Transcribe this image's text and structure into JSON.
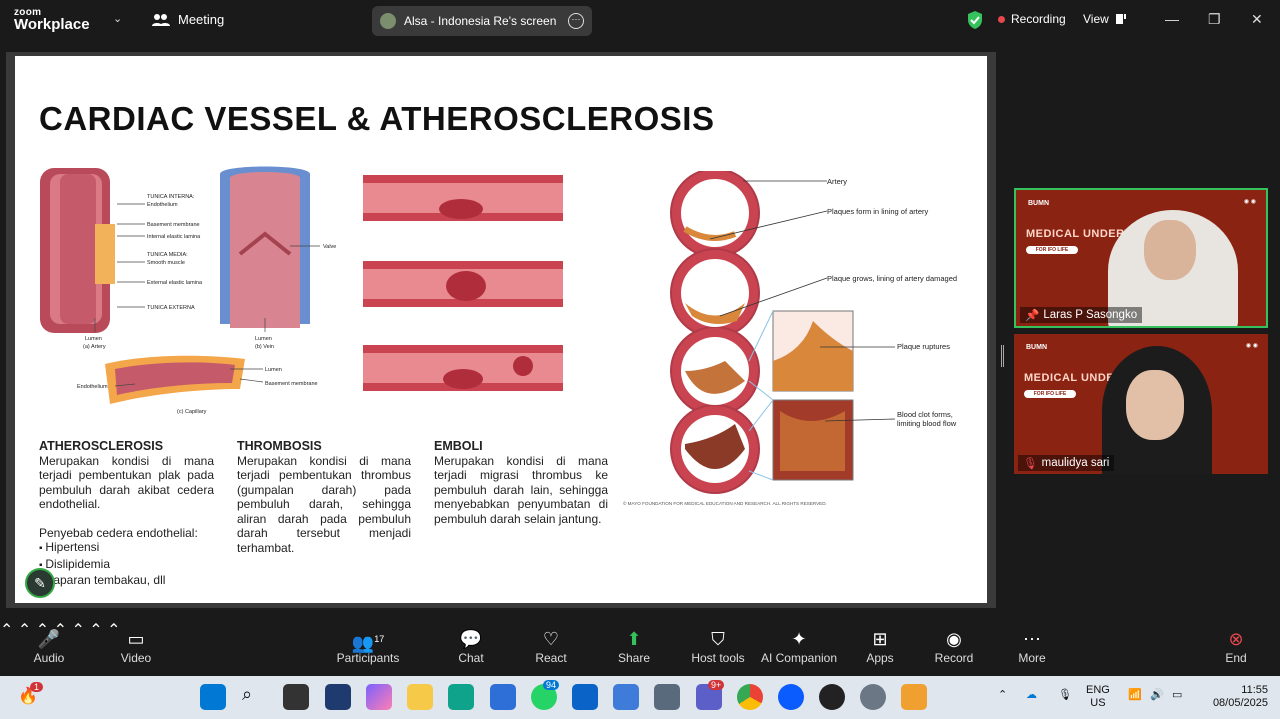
{
  "app": {
    "brand_line1": "zoom",
    "brand_line2": "Workplace",
    "meeting_label": "Meeting",
    "share_label": "Alsa - Indonesia Re's screen",
    "recording": "Recording",
    "view": "View"
  },
  "slide": {
    "title": "CARDIAC VESSEL & ATHEROSCLEROSIS",
    "vessel_labels": {
      "tunica_interna": "TUNICA INTERNA:",
      "endothelium": "Endothelium",
      "basement": "Basement membrane",
      "internal_elastic": "Internal elastic lamina",
      "tunica_media": "TUNICA MEDIA:",
      "smooth": "Smooth muscle",
      "external_elastic": "External elastic lamina",
      "tunica_externa": "TUNICA EXTERNA",
      "valve": "Valve",
      "lumen_a": "Lumen",
      "artery": "(a) Artery",
      "lumen_b": "Lumen",
      "vein": "(b) Vein",
      "lumen_c": "Lumen",
      "endothelium_c": "Endothelium",
      "basement_c": "Basement membrane",
      "capillary": "(c) Capillary"
    },
    "plaque_labels": {
      "artery": "Artery",
      "p1": "Plaques form in lining of artery",
      "p2": "Plaque grows, lining of artery damaged",
      "p3": "Plaque ruptures",
      "p4a": "Blood clot forms,",
      "p4b": "limiting blood flow",
      "copyright": "© MAYO FOUNDATION FOR MEDICAL EDUCATION AND RESEARCH. ALL RIGHTS RESERVED."
    },
    "atherosclerosis": {
      "heading": "ATHEROSCLEROSIS",
      "body": "Merupakan kondisi di mana terjadi pembentukan plak pada pembuluh darah akibat cedera endothelial.",
      "causes_title": "Penyebab cedera endothelial:",
      "causes": [
        "Hipertensi",
        "Dislipidemia",
        "Paparan tembakau, dll"
      ]
    },
    "thrombosis": {
      "heading": "THROMBOSIS",
      "body": "Merupakan kondisi di mana terjadi pembentukan thrombus (gumpalan darah) pada pembuluh darah, sehingga aliran darah pada pembuluh darah tersebut menjadi terhambat."
    },
    "emboli": {
      "heading": "EMBOLI",
      "body": "Merupakan kondisi di mana terjadi migrasi thrombus ke pembuluh darah lain, sehingga menyebabkan penyumbatan di pembuluh darah selain jantung."
    }
  },
  "participants_tiles": [
    {
      "name": "Laras P Sasongko",
      "banner": "MEDICAL UNDERW     AINING",
      "sub": "FOR IFO LIFE"
    },
    {
      "name": "maulidya sari",
      "banner": "MEDICAL UNDE         AINING",
      "sub": "FOR IFO LIFE"
    }
  ],
  "toolbar": {
    "audio": "Audio",
    "video": "Video",
    "participants": "Participants",
    "participants_count": "17",
    "chat": "Chat",
    "react": "React",
    "share": "Share",
    "host_tools": "Host tools",
    "ai": "AI Companion",
    "apps": "Apps",
    "record": "Record",
    "more": "More",
    "end": "End"
  },
  "taskbar": {
    "notif_badge": "1",
    "whatsapp_badge": "94",
    "teams_badge": "9+",
    "lang1": "ENG",
    "lang2": "US",
    "time": "11:55",
    "date": "08/05/2025"
  },
  "colors": {
    "accent_green": "#35c15b",
    "record_red": "#e5484d",
    "tile_bg": "#8b2313",
    "zoom_blue": "#0b5cff"
  }
}
